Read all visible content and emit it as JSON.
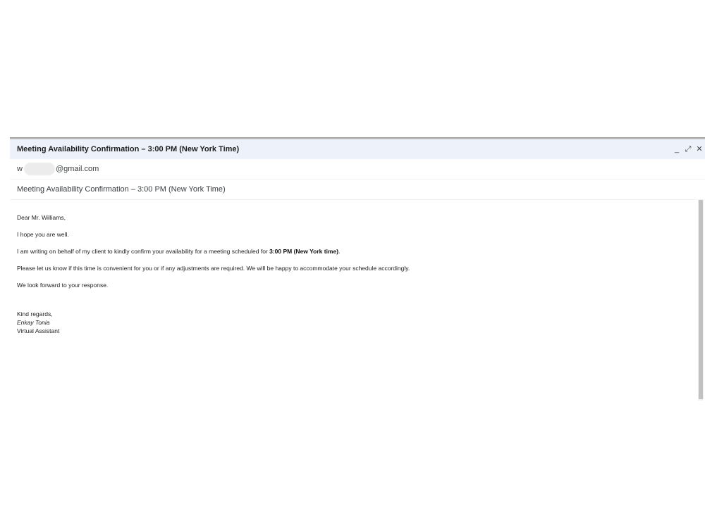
{
  "compose": {
    "title": "Meeting Availability Confirmation – 3:00 PM (New York Time)",
    "controls": {
      "minimize": "_",
      "expand": "⤢",
      "close": "✕"
    },
    "to": {
      "prefix": "w",
      "suffix": "@gmail.com"
    },
    "subject": "Meeting Availability Confirmation – 3:00 PM (New York Time)"
  },
  "body": {
    "greeting": "Dear Mr. Williams,",
    "line1": "I hope you are well.",
    "line2_before": "I am writing on behalf of my client to kindly confirm your availability for a meeting scheduled for ",
    "line2_bold": "3:00 PM (New York time)",
    "line2_after": ".",
    "line3": "Please let us know if this time is convenient for you or if any adjustments are required. We will be happy to accommodate your schedule accordingly.",
    "line4": "We look forward to your response.",
    "closing": "Kind regards,",
    "sender_name": "Enkay Tonia",
    "sender_title": "Virtual Assistant"
  }
}
